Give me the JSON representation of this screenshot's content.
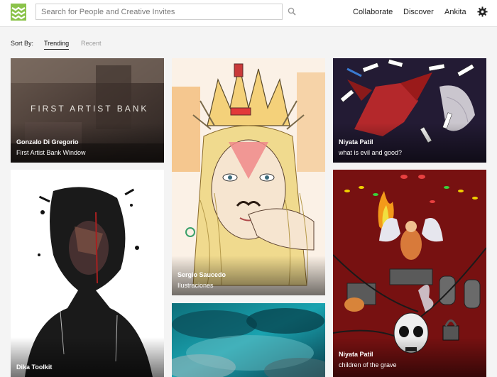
{
  "search": {
    "placeholder": "Search for People and Creative Invites"
  },
  "nav": {
    "collaborate": "Collaborate",
    "discover": "Discover",
    "user": "Ankita"
  },
  "sort": {
    "label": "Sort By:",
    "tabs": [
      "Trending",
      "Recent"
    ],
    "active": "Trending"
  },
  "colors": {
    "brand": "#8bc34a",
    "text": "#222222",
    "muted": "#9a9a9a"
  },
  "cards": [
    {
      "author": "Gonzalo Di Gregorio",
      "title": "First Artist Bank Window",
      "art_text": "FIRST ARTIST BANK"
    },
    {
      "author": "Sergio Saucedo",
      "title": "Ilustraciones"
    },
    {
      "author": "Niyata Patil",
      "title": "what is evil and good?"
    },
    {
      "author": "Dika Toolkit",
      "title": ""
    },
    {
      "author": "",
      "title": ""
    },
    {
      "author": "Niyata Patil",
      "title": "children of the grave"
    }
  ]
}
